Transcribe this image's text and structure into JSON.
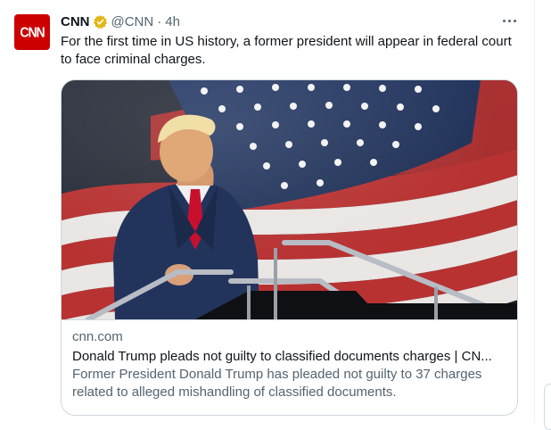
{
  "tweet": {
    "avatar_text": "CNN",
    "name": "CNN",
    "handle": "@CNN",
    "separator": "·",
    "time": "4h",
    "text": "For the first time in US history, a former president will appear in federal court to face criminal charges."
  },
  "card": {
    "image_alt": "Donald Trump on stairs in front of an American flag",
    "domain": "cnn.com",
    "title": "Donald Trump pleads not guilty to classified documents charges | CN...",
    "description": "Former President Donald Trump has pleaded not guilty to 37 charges related to alleged mishandling of classified documents."
  },
  "icons": {
    "verified": "verified-badge-icon",
    "more": "more-options-icon"
  },
  "colors": {
    "cnn_red": "#cc0000",
    "verified_gold": "#e2b719",
    "secondary_text": "#536471",
    "border": "#cfd9de"
  }
}
